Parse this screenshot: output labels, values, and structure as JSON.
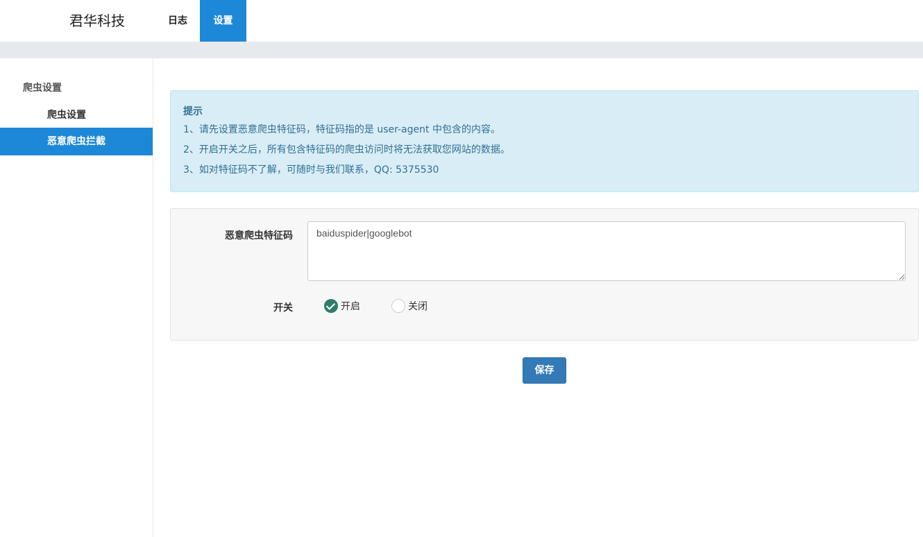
{
  "header": {
    "brand": "君华科技",
    "tabs": [
      {
        "label": "日志",
        "active": false
      },
      {
        "label": "设置",
        "active": true
      }
    ]
  },
  "sidebar": {
    "group": "爬虫设置",
    "items": [
      {
        "label": "爬虫设置",
        "active": false
      },
      {
        "label": "恶意爬虫拦截",
        "active": true
      }
    ]
  },
  "alert": {
    "title": "提示",
    "lines": [
      "1、请先设置恶意爬虫特征码，特征码指的是 user-agent 中包含的内容。",
      "2、开启开关之后，所有包含特征码的爬虫访问时将无法获取您网站的数据。",
      "3、如对特征码不了解，可随时与我们联系，QQ: 5375530"
    ]
  },
  "form": {
    "ua_label": "恶意爬虫特征码",
    "ua_value": "baiduspider|googlebot",
    "switch_label": "开关",
    "options": [
      {
        "label": "开启",
        "checked": true
      },
      {
        "label": "关闭",
        "checked": false
      }
    ]
  },
  "actions": {
    "save_label": "保存"
  },
  "colors": {
    "primary": "#1e88d8",
    "button": "#337ab7",
    "alert_bg": "#d9edf7",
    "alert_text": "#31708f",
    "radio_checked": "#2e7d6b"
  }
}
